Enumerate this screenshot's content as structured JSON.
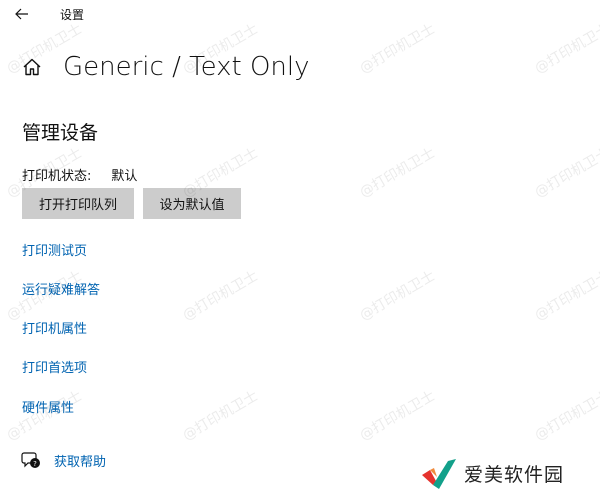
{
  "window": {
    "title": "设置"
  },
  "header": {
    "title": "Generic / Text Only"
  },
  "section": {
    "title": "管理设备"
  },
  "status": {
    "label": "打印机状态:",
    "value": "默认"
  },
  "buttons": {
    "open_queue": "打开打印队列",
    "set_default": "设为默认值"
  },
  "links": [
    "打印测试页",
    "运行疑难解答",
    "打印机属性",
    "打印首选项",
    "硬件属性"
  ],
  "help": {
    "label": "获取帮助"
  },
  "watermark": {
    "text": "@打印机卫士"
  },
  "brand": {
    "text": "爱美软件园"
  },
  "colors": {
    "link": "#0063b1",
    "button_bg": "#cccccc",
    "logo_red": "#e5322d",
    "logo_teal": "#12a08a"
  },
  "icons": {
    "back": "back-arrow-icon",
    "home": "home-icon",
    "help": "help-chat-icon"
  }
}
